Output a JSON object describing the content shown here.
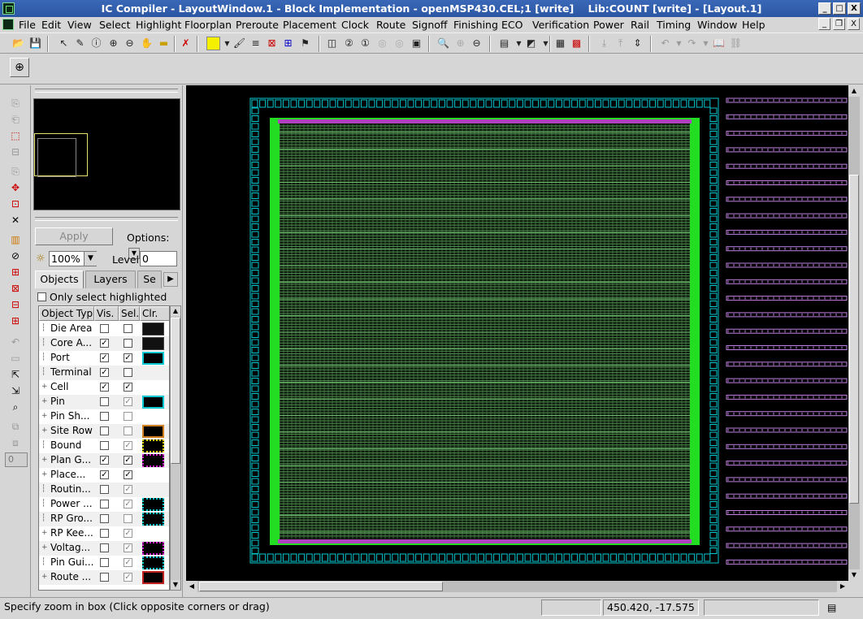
{
  "window": {
    "title": "IC Compiler - LayoutWindow.1 - Block Implementation - openMSP430.CEL;1 [write]    Lib:COUNT [write] - [Layout.1]",
    "minimize": "_",
    "maximize": "□",
    "close": "X"
  },
  "menu": [
    "File",
    "Edit",
    "View",
    "Select",
    "Highlight",
    "Floorplan",
    "Preroute",
    "Placement",
    "Clock",
    "Route",
    "Signoff",
    "Finishing",
    "ECO",
    "Verification",
    "Power",
    "Rail",
    "Timing",
    "Window",
    "Help"
  ],
  "panel": {
    "apply_label": "Apply",
    "options_label": "Options:",
    "zoom_value": "100%",
    "level_label": "Level",
    "level_value": "0",
    "tabs": [
      "Objects",
      "Layers",
      "Se"
    ],
    "only_select_highlighted": "Only select highlighted",
    "table_headers": [
      "Object Typ",
      "Vis.",
      "Sel.",
      "Clr."
    ],
    "rows": [
      {
        "name": "Die Area",
        "expand": false,
        "vis": false,
        "sel": false,
        "sel_disabled": false,
        "color": "#111111",
        "hatch": "none"
      },
      {
        "name": "Core A...",
        "expand": false,
        "vis": true,
        "sel": false,
        "sel_disabled": false,
        "color": "#111111",
        "hatch": "none"
      },
      {
        "name": "Port",
        "expand": false,
        "vis": true,
        "sel": true,
        "sel_disabled": false,
        "color": "#00c8d0",
        "hatch": "outline"
      },
      {
        "name": "Terminal",
        "expand": false,
        "vis": true,
        "sel": false,
        "sel_disabled": false,
        "color": "",
        "hatch": "none"
      },
      {
        "name": "Cell",
        "expand": true,
        "vis": true,
        "sel": true,
        "sel_disabled": false,
        "color": "",
        "hatch": "none"
      },
      {
        "name": "Pin",
        "expand": true,
        "vis": false,
        "sel": true,
        "sel_disabled": true,
        "color": "#00c8d0",
        "hatch": "outline"
      },
      {
        "name": "Pin Sh...",
        "expand": true,
        "vis": false,
        "sel": false,
        "sel_disabled": true,
        "color": "",
        "hatch": "none"
      },
      {
        "name": "Site Row",
        "expand": true,
        "vis": false,
        "sel": false,
        "sel_disabled": true,
        "color": "#d08020",
        "hatch": "outline"
      },
      {
        "name": "Bound",
        "expand": false,
        "vis": false,
        "sel": true,
        "sel_disabled": true,
        "color": "#e0d000",
        "hatch": "dots"
      },
      {
        "name": "Plan G...",
        "expand": true,
        "vis": true,
        "sel": true,
        "sel_disabled": false,
        "color": "#d020d0",
        "hatch": "dots"
      },
      {
        "name": "Place...",
        "expand": true,
        "vis": true,
        "sel": true,
        "sel_disabled": false,
        "color": "",
        "hatch": "none"
      },
      {
        "name": "Routin...",
        "expand": false,
        "vis": false,
        "sel": true,
        "sel_disabled": true,
        "color": "",
        "hatch": "none"
      },
      {
        "name": "Power ...",
        "expand": false,
        "vis": false,
        "sel": true,
        "sel_disabled": true,
        "color": "#00c8d0",
        "hatch": "dots"
      },
      {
        "name": "RP Gro...",
        "expand": false,
        "vis": false,
        "sel": false,
        "sel_disabled": true,
        "color": "#00c8d0",
        "hatch": "dots"
      },
      {
        "name": "RP Kee...",
        "expand": true,
        "vis": false,
        "sel": true,
        "sel_disabled": true,
        "color": "",
        "hatch": "none"
      },
      {
        "name": "Voltag...",
        "expand": true,
        "vis": false,
        "sel": true,
        "sel_disabled": true,
        "color": "#d020d0",
        "hatch": "dots"
      },
      {
        "name": "Pin Gui...",
        "expand": false,
        "vis": false,
        "sel": true,
        "sel_disabled": true,
        "color": "#00c8d0",
        "hatch": "dots"
      },
      {
        "name": "Route ...",
        "expand": true,
        "vis": false,
        "sel": true,
        "sel_disabled": true,
        "color": "#c02020",
        "hatch": "outline"
      }
    ]
  },
  "left_tools": {
    "level_value": "0"
  },
  "colors": {
    "title_bg": "#2b56a3",
    "core_border": "#22dd22",
    "power_rail": "#b040c0",
    "row_line": "#4a8a4a",
    "io_pad": "#00c8d0",
    "right_cells": "#c080e0"
  },
  "status": {
    "message": "Specify zoom in box (Click opposite corners or drag)",
    "coords": "450.420, -17.575"
  }
}
